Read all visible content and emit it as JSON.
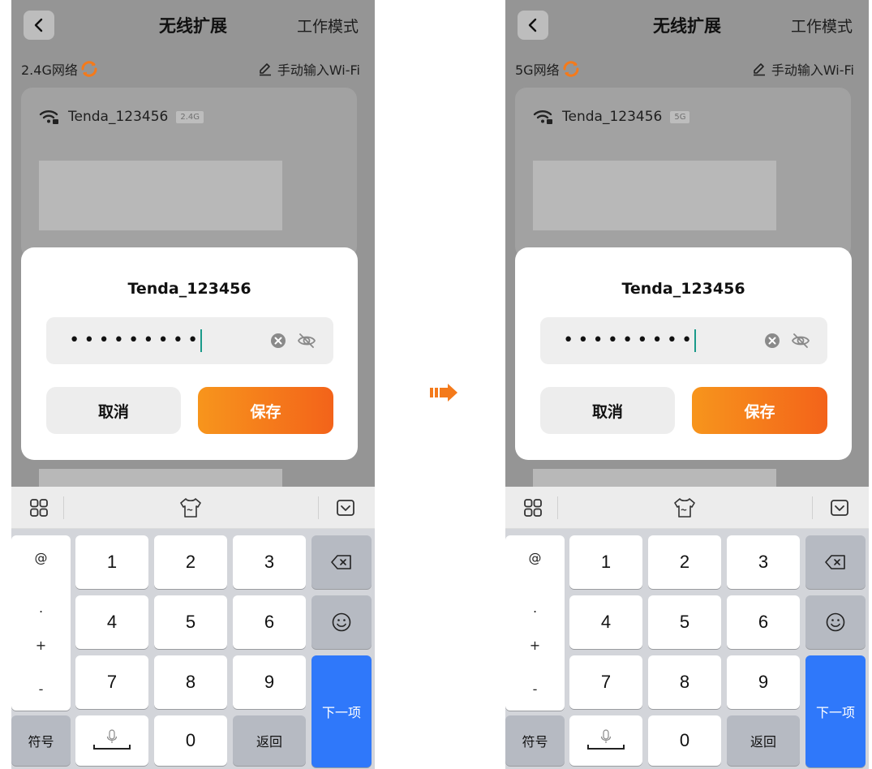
{
  "screens": [
    {
      "header": {
        "title": "无线扩展",
        "mode_label": "工作模式"
      },
      "band_label": "2.4G网络",
      "manual_label": "手动输入Wi-Fi",
      "network": {
        "ssid": "Tenda_123456",
        "band_tag": "2.4G"
      },
      "dialog": {
        "title": "Tenda_123456",
        "password_value": "•••••••••",
        "cancel_label": "取消",
        "save_label": "保存"
      },
      "keyboard": {
        "symbols": [
          "@",
          ".",
          "+",
          "-"
        ],
        "digits": [
          "1",
          "2",
          "3",
          "4",
          "5",
          "6",
          "7",
          "8",
          "9",
          "0"
        ],
        "symbol_key": "符号",
        "return_key": "返回",
        "next_key": "下一项"
      }
    },
    {
      "header": {
        "title": "无线扩展",
        "mode_label": "工作模式"
      },
      "band_label": "5G网络",
      "manual_label": "手动输入Wi-Fi",
      "network": {
        "ssid": "Tenda_123456",
        "band_tag": "5G"
      },
      "dialog": {
        "title": "Tenda_123456",
        "password_value": "•••••••••",
        "cancel_label": "取消",
        "save_label": "保存"
      },
      "keyboard": {
        "symbols": [
          "@",
          ".",
          "+",
          "-"
        ],
        "digits": [
          "1",
          "2",
          "3",
          "4",
          "5",
          "6",
          "7",
          "8",
          "9",
          "0"
        ],
        "symbol_key": "符号",
        "return_key": "返回",
        "next_key": "下一项"
      }
    }
  ],
  "colors": {
    "accent_orange": "#f47a1b",
    "next_key_blue": "#2f78fa",
    "caret_teal": "#1a9a8a",
    "overlay_gray": "#959595"
  }
}
